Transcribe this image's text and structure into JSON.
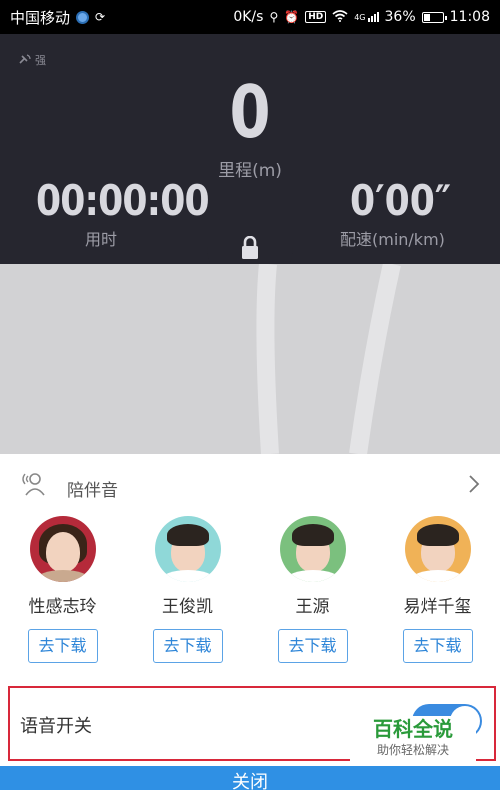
{
  "status_bar": {
    "carrier": "中国移动",
    "network_speed": "0K/s",
    "network_type": "4G",
    "battery": "36%",
    "battery_level": 0.36,
    "time": "11:08"
  },
  "run_panel": {
    "gps_label": "强",
    "distance_value": "0",
    "distance_label": "里程(m)",
    "time_value": "00:00:00",
    "time_label": "用时",
    "pace_value": "0′00″",
    "pace_label": "配速(min/km)"
  },
  "companion": {
    "title": "陪伴音",
    "voices": [
      {
        "name": "性感志玲",
        "button": "去下载"
      },
      {
        "name": "王俊凯",
        "button": "去下载"
      },
      {
        "name": "王源",
        "button": "去下载"
      },
      {
        "name": "易烊千玺",
        "button": "去下载"
      }
    ]
  },
  "voice_switch": {
    "label": "语音开关",
    "enabled": true
  },
  "watermark": {
    "title": "百科全说",
    "subtitle": "助你轻松解决"
  },
  "bottom_button": {
    "label": "关闭"
  },
  "colors": {
    "panel": "#26262f",
    "map": "#d2d2d4",
    "accent": "#2f90e4",
    "highlight": "#d8283a"
  }
}
